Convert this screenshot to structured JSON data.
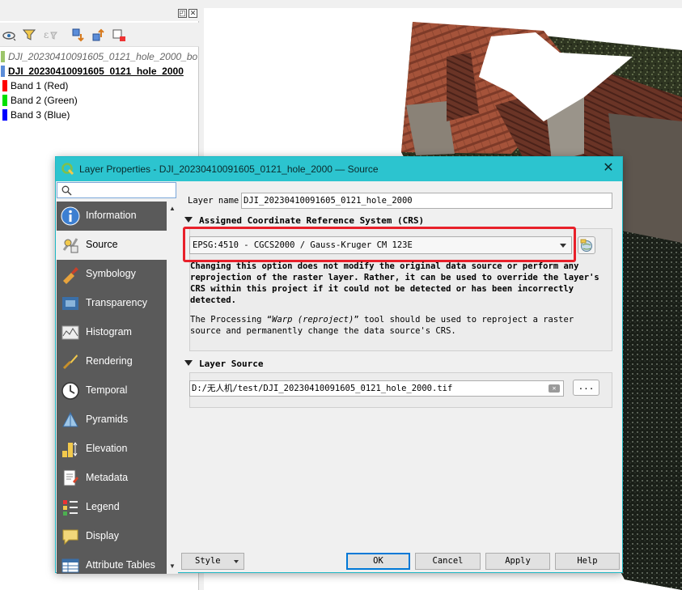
{
  "layers_panel": {
    "layers": [
      {
        "name": "DJI_20230410091605_0121_hole_2000_bo",
        "style": "italic-gray"
      },
      {
        "name": "DJI_20230410091605_0121_hole_2000",
        "style": "bold-underline"
      },
      {
        "name": "Band 1 (Red)",
        "color": "#ff0000"
      },
      {
        "name": "Band 2 (Green)",
        "color": "#00e000"
      },
      {
        "name": "Band 3 (Blue)",
        "color": "#0000ff"
      }
    ],
    "toolbar_icons": [
      "eye-icon",
      "filter-icon",
      "expression-filter-icon",
      "expand-all-icon",
      "collapse-all-icon",
      "remove-layer-icon"
    ]
  },
  "dialog": {
    "title": "Layer Properties - DJI_20230410091605_0121_hole_2000 — Source",
    "search_value": "",
    "nav_items": [
      {
        "label": "Information",
        "icon": "info-icon"
      },
      {
        "label": "Source",
        "icon": "source-icon"
      },
      {
        "label": "Symbology",
        "icon": "symbology-icon"
      },
      {
        "label": "Transparency",
        "icon": "transparency-icon"
      },
      {
        "label": "Histogram",
        "icon": "histogram-icon"
      },
      {
        "label": "Rendering",
        "icon": "rendering-icon"
      },
      {
        "label": "Temporal",
        "icon": "clock-icon"
      },
      {
        "label": "Pyramids",
        "icon": "pyramids-icon"
      },
      {
        "label": "Elevation",
        "icon": "elevation-icon"
      },
      {
        "label": "Metadata",
        "icon": "metadata-icon"
      },
      {
        "label": "Legend",
        "icon": "legend-icon"
      },
      {
        "label": "Display",
        "icon": "display-icon"
      },
      {
        "label": "Attribute Tables",
        "icon": "attribute-tables-icon"
      }
    ],
    "active_nav": "Source",
    "layer_name_label": "Layer name",
    "layer_name_value": "DJI_20230410091605_0121_hole_2000",
    "crs_section": {
      "title": "Assigned Coordinate Reference System (CRS)",
      "selected": "EPSG:4510 - CGCS2000 / Gauss-Kruger CM 123E",
      "warning": "Changing this option does not modify the original data source or perform any reprojection of the raster layer. Rather, it can be used to override the layer's CRS within this project if it could not be detected or has been incorrectly detected.",
      "note_before": "The Processing “",
      "note_italic": "Warp (reproject)",
      "note_after": "” tool should be used to reproject a raster source and permanently change the data source's CRS.",
      "highlight_color": "#e8202a"
    },
    "source_section": {
      "title": "Layer Source",
      "path": "D:/无人机/test/DJI_20230410091605_0121_hole_2000.tif",
      "browse_label": "..."
    },
    "buttons": {
      "style": "Style",
      "ok": "OK",
      "cancel": "Cancel",
      "apply": "Apply",
      "help": "Help"
    },
    "accent_color": "#2cc4cf"
  }
}
